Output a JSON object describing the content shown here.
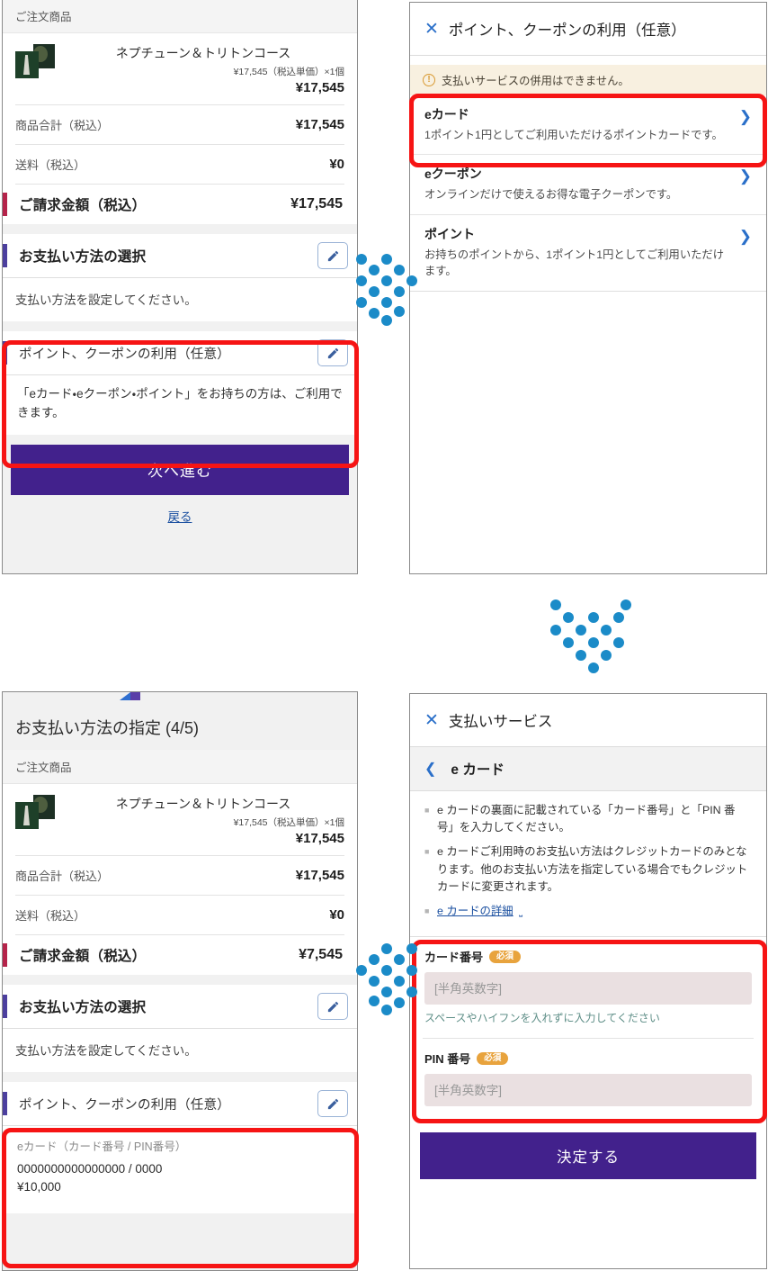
{
  "colors": {
    "brand_purple": "#42218c",
    "accent_bar_purple": "#4c3f9e",
    "accent_bar_crimson": "#b5234a",
    "link_blue": "#1a4fa0",
    "chevron_blue": "#2a6fc9",
    "required_orange": "#e8a33d",
    "annotation_red": "#f61414",
    "arrow_blue": "#1b8bc8",
    "warning_bg": "#f8f0e0",
    "input_bg": "#eae0e1",
    "helper_teal": "#5f8f88"
  },
  "panel_top_left": {
    "order_section_header": "ご注文商品",
    "product": {
      "name": "ネプチューン＆トリトンコース",
      "unit_price_line": "¥17,545（税込単価）×1個",
      "line_total": "¥17,545",
      "thumbnail_icon": "product-thumbnail"
    },
    "amount_rows": [
      {
        "label": "商品合計（税込）",
        "value": "¥17,545"
      },
      {
        "label": "送料（税込）",
        "value": "¥0"
      }
    ],
    "billing": {
      "label": "ご請求金額（税込）",
      "value": "¥17,545"
    },
    "payment_method_section": {
      "title": "お支払い方法の選択",
      "edit_icon": "pencil-icon",
      "note": "支払い方法を設定してください。"
    },
    "points_coupon_section": {
      "title": "ポイント、クーポンの利用（任意）",
      "edit_icon": "pencil-icon",
      "note": "「eカード・eクーポン・ポイント」をお持ちの方は、ご利用できます。"
    },
    "cta_label": "次へ進む",
    "back_label": "戻る"
  },
  "panel_top_right": {
    "close_icon": "close-icon",
    "title": "ポイント、クーポンの利用（任意）",
    "warning": {
      "icon": "warning-exclamation-icon",
      "text": "支払いサービスの併用はできません。"
    },
    "services": [
      {
        "name": "eカード",
        "desc": "1ポイント1円としてご利用いただけるポイントカードです。",
        "chevron_icon": "chevron-right-icon"
      },
      {
        "name": "eクーポン",
        "desc": "オンラインだけで使えるお得な電子クーポンです。",
        "chevron_icon": "chevron-right-icon"
      },
      {
        "name": "ポイント",
        "desc": "お持ちのポイントから、1ポイント1円としてご利用いただけます。",
        "chevron_icon": "chevron-right-icon"
      }
    ]
  },
  "panel_bottom_left": {
    "page_title": "お支払い方法の指定 (4/5)",
    "order_section_header": "ご注文商品",
    "product": {
      "name": "ネプチューン＆トリトンコース",
      "unit_price_line": "¥17,545（税込単価）×1個",
      "line_total": "¥17,545",
      "thumbnail_icon": "product-thumbnail"
    },
    "amount_rows": [
      {
        "label": "商品合計（税込）",
        "value": "¥17,545"
      },
      {
        "label": "送料（税込）",
        "value": "¥0"
      }
    ],
    "billing": {
      "label": "ご請求金額（税込）",
      "value": "¥7,545"
    },
    "payment_method_section": {
      "title": "お支払い方法の選択",
      "edit_icon": "pencil-icon",
      "note": "支払い方法を設定してください。"
    },
    "points_coupon_section": {
      "title": "ポイント、クーポンの利用（任意）",
      "edit_icon": "pencil-icon",
      "applied_label": "eカード（カード番号 / PIN番号）",
      "applied_number": "0000000000000000 / 0000",
      "applied_amount": "¥10,000"
    }
  },
  "panel_bottom_right": {
    "close_icon": "close-icon",
    "title": "支払いサービス",
    "sub_back_icon": "chevron-left-icon",
    "sub_title": "e カード",
    "bullets": [
      {
        "text": "e カードの裏面に記載されている「カード番号」と「PIN 番号」を入力してください。",
        "is_link": false
      },
      {
        "text": "e カードご利用時のお支払い方法はクレジットカードのみとなります。他のお支払い方法を指定している場合でもクレジットカードに変更されます。",
        "is_link": false
      },
      {
        "text": "e カードの詳細",
        "is_link": true,
        "external_icon": "external-link-icon"
      }
    ],
    "fields": [
      {
        "label": "カード番号",
        "required_badge": "必須",
        "value": "",
        "placeholder": "[半角英数字]",
        "helper": "スペースやハイフンを入れずに入力してください"
      },
      {
        "label": "PIN 番号",
        "required_badge": "必須",
        "value": "",
        "placeholder": "[半角英数字]",
        "helper": ""
      }
    ],
    "cta_label": "決定する"
  },
  "annotations": {
    "arrow_top_right_icon": "dotted-arrow-right",
    "arrow_down_icon": "dotted-arrow-down",
    "arrow_bottom_left_icon": "dotted-arrow-left",
    "highlight_count": 5
  }
}
